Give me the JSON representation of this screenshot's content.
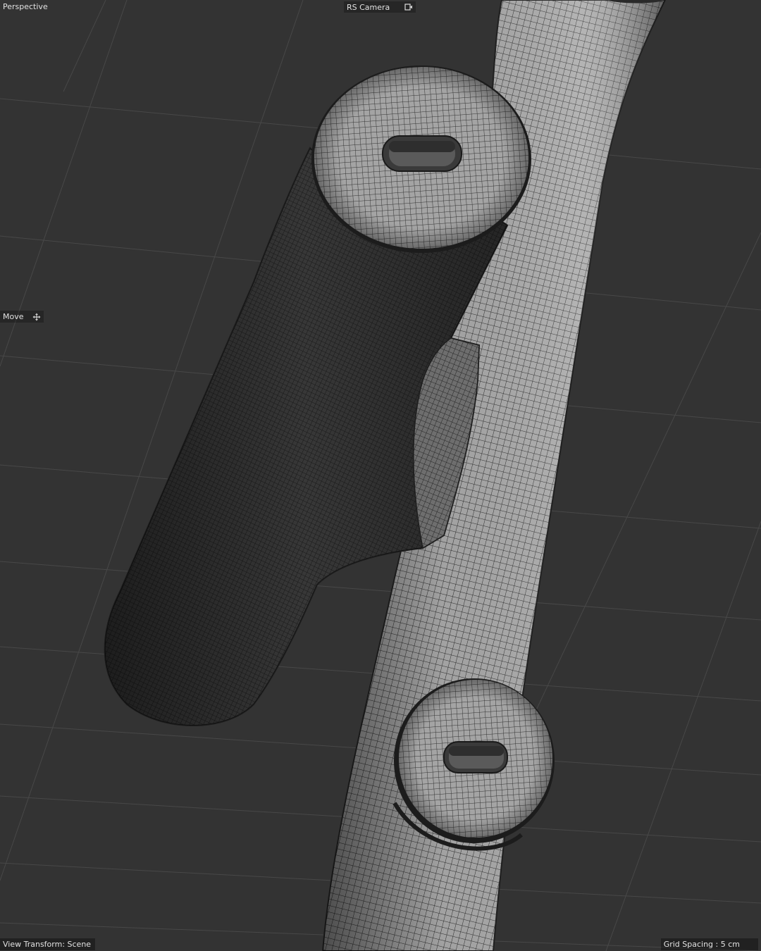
{
  "viewport": {
    "view_name": "Perspective",
    "camera_name": "RS Camera",
    "active_tool": "Move",
    "view_transform": "View Transform: Scene",
    "grid_spacing": "Grid Spacing : 5 cm"
  },
  "icons": {
    "camera": "camera-lock-icon",
    "tool": "move-arrows-icon"
  },
  "colors": {
    "background": "#333333",
    "grid": "#454545",
    "mesh_light": "#b0b0b0",
    "mesh_mid": "#7a7a7a",
    "mesh_dark": "#2e2e2e",
    "text": "#e2e2e2"
  }
}
